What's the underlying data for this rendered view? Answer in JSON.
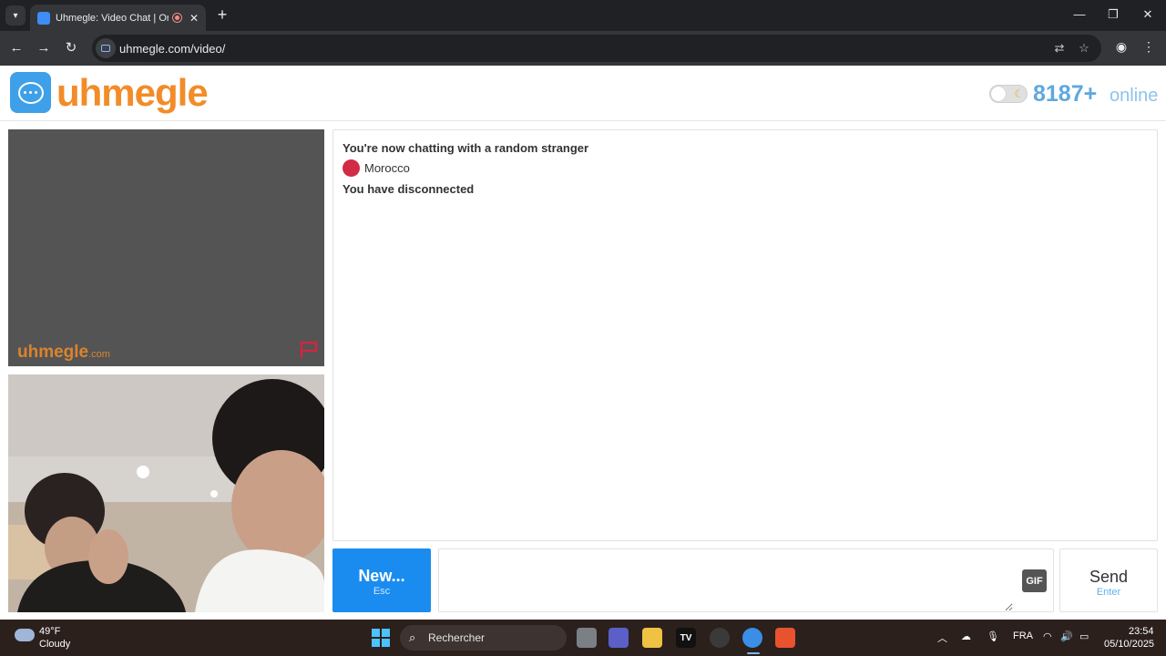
{
  "browser": {
    "tab_title": "Uhmegle: Video Chat | Ome",
    "url": "uhmegle.com/video/",
    "icons": [
      "tab-search-icon",
      "recording-icon",
      "close-icon",
      "new-tab-icon",
      "back-icon",
      "forward-icon",
      "reload-icon",
      "translate-icon",
      "bookmark-star-icon",
      "profile-icon",
      "menu-icon",
      "minimize-icon",
      "maximize-icon",
      "window-close-icon"
    ]
  },
  "header": {
    "logo_text": "uhmegle",
    "online_count": "8187+",
    "online_label": "online",
    "brand_color": "#f28c28",
    "accent_color": "#3ea0e8"
  },
  "video": {
    "watermark_brand": "uhmegle",
    "watermark_tld": ".com"
  },
  "chat": {
    "intro": "You're now chatting with a random stranger",
    "country": "Morocco",
    "status": "You have disconnected"
  },
  "controls": {
    "new_label": "New...",
    "new_hint": "Esc",
    "gif_label": "GIF",
    "send_label": "Send",
    "send_hint": "Enter",
    "message_value": ""
  },
  "taskbar": {
    "temperature": "49°F",
    "condition": "Cloudy",
    "search_placeholder": "Rechercher",
    "language": "FRA",
    "time": "23:54",
    "date": "05/10/2025"
  }
}
